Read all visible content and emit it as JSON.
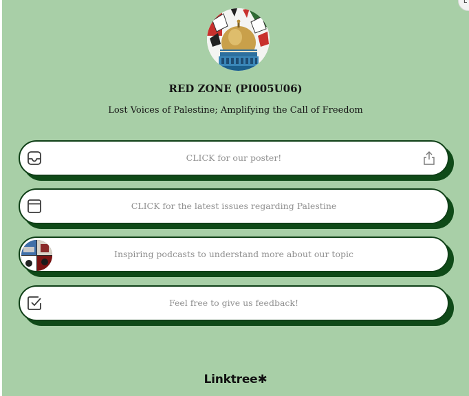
{
  "profile": {
    "name": "RED ZONE (PI005U06)",
    "bio": "Lost Voices of Palestine; Amplifying the Call of Freedom"
  },
  "links": [
    {
      "label": "CLICK for our poster!",
      "icon": "inbox-icon",
      "has_share": true
    },
    {
      "label": "CLICK for the latest issues regarding Palestine",
      "icon": "browser-window-icon",
      "has_share": false
    },
    {
      "label": "Inspiring podcasts to understand more about our topic",
      "icon": "podcast-thumbnail",
      "has_share": false
    },
    {
      "label": "Feel free to give us feedback!",
      "icon": "checkbox-icon",
      "has_share": false
    }
  ],
  "footer": {
    "brand": "Linktree✱"
  },
  "colors": {
    "background": "#a8cfa7",
    "card_border": "#0f3f17",
    "card_shadow": "#0f4a18",
    "card_text": "#8f8f8f"
  }
}
